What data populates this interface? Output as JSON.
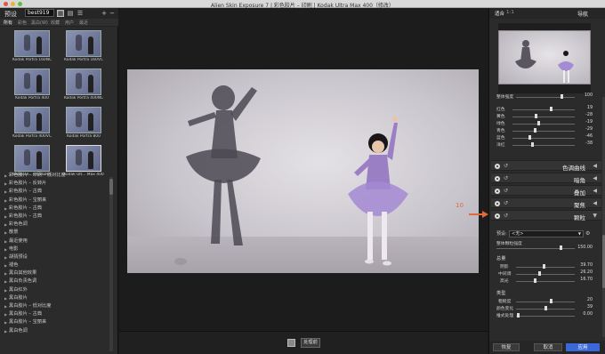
{
  "window": {
    "title": "Alien Skin Exposure 7 | 彩色胶片 – 印刷 | Kodak Ultra Max 400（修改）"
  },
  "left_panel": {
    "title": "预设",
    "search_value": "best919",
    "tabs": [
      "所有",
      "彩色",
      "黑白(W)",
      "收藏",
      "用户",
      "最近"
    ],
    "thumbnails": [
      "Kodak Portra 160NC",
      "Kodak Portra 160VC",
      "Kodak Portra 400",
      "Kodak Portra 400NC",
      "Kodak Portra 400VC",
      "Kodak Portra 800",
      "Kodak Ul... or 100UC",
      "Kodak Ult... Max 400"
    ],
    "presets": [
      "彩色胶片 – 印刷 – 低对比度",
      "彩色胶片 – 反转片",
      "彩色胶片 – 古典",
      "彩色胶片 – 宝丽来",
      "彩色胶片 – 古典",
      "彩色胶片 – 古典",
      "彩色色调",
      "散景",
      "最近使用",
      "电影",
      "胡猜预设",
      "褪色",
      "黑白其他效果",
      "黑白负责色调",
      "黑白红外",
      "黑白胶片",
      "黑白胶片 – 低对比度",
      "黑白胶片 – 古典",
      "黑白胶片 – 宝丽来",
      "黑白色调"
    ]
  },
  "canvas": {
    "bottom_button": "处理前"
  },
  "annotation": {
    "number": "10"
  },
  "right_panel": {
    "fit_label": "适合",
    "ratio_label": "1:1",
    "nav_label": "导航",
    "overall_intensity": {
      "label": "整体强度",
      "value": "100",
      "level": 0.78
    },
    "color_sliders": [
      {
        "label": "红色",
        "value": "19",
        "level": 0.62
      },
      {
        "label": "黄色",
        "value": "-28",
        "level": 0.38
      },
      {
        "label": "绿色",
        "value": "-19",
        "level": 0.42
      },
      {
        "label": "青色",
        "value": "-29",
        "level": 0.36
      },
      {
        "label": "蓝色",
        "value": "-46",
        "level": 0.28
      },
      {
        "label": "洋红",
        "value": "-38",
        "level": 0.32
      }
    ],
    "sections": [
      "色调曲线",
      "暗角",
      "叠加",
      "聚焦",
      "颗粒"
    ],
    "grain": {
      "preset_label": "预设:",
      "preset_value": "<无>",
      "overall_label": "整体颗粒强度",
      "overall_value": "150.00",
      "overall_level": 0.82,
      "amount_head": "总量",
      "amount": [
        {
          "label": "阴影",
          "value": "39.70",
          "level": 0.48
        },
        {
          "label": "中间调",
          "value": "26.20",
          "level": 0.4
        },
        {
          "label": "高光",
          "value": "16.70",
          "level": 0.32
        }
      ],
      "type_head": "类型",
      "type": [
        {
          "label": "粗糙度",
          "value": "20",
          "level": 0.6
        },
        {
          "label": "颜色变化",
          "value": "39",
          "level": 0.5
        },
        {
          "label": "推式处理",
          "value": "0.00",
          "level": 0.04
        }
      ]
    },
    "footer": {
      "reset": "恢复",
      "cancel": "取消",
      "apply": "应用"
    }
  },
  "colors": {
    "accent": "#3b68d8",
    "annotation": "#e06a3a"
  }
}
